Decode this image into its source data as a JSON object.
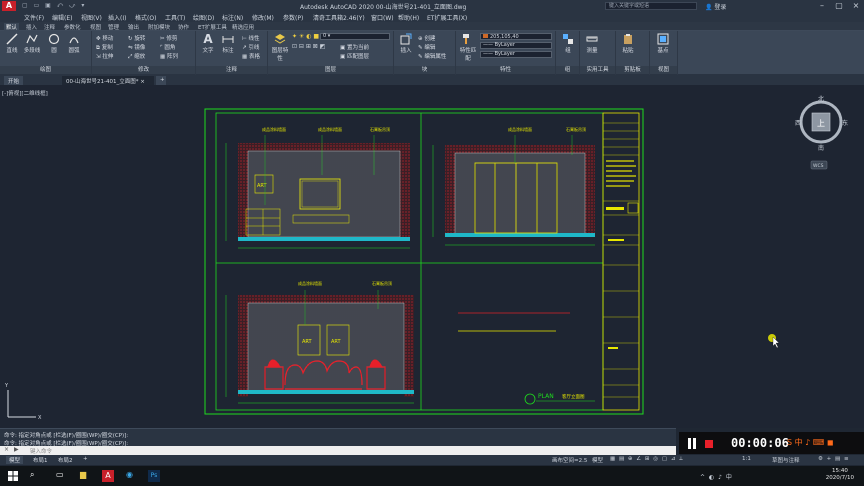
{
  "window": {
    "app_logo": "A",
    "title": "Autodesk AutoCAD 2020    00-山海世号21-401_立面图.dwg",
    "search_placeholder": "键入关键字或短语",
    "user_label": "登录"
  },
  "menubar": [
    "文件(F)",
    "编辑(E)",
    "视图(V)",
    "插入(I)",
    "格式(O)",
    "工具(T)",
    "绘图(D)",
    "标注(N)",
    "修改(M)",
    "参数(P)",
    "清奇工具箱2.46(Y)",
    "窗口(W)",
    "帮助(H)",
    "ET扩展工具(X)"
  ],
  "ribbon_tabs": [
    "默认",
    "插入",
    "注释",
    "参数化",
    "视图",
    "管理",
    "输出",
    "附加模块",
    "协作",
    "ET扩展工具",
    "精选应用"
  ],
  "ribbon": {
    "draw": {
      "title": "绘图",
      "tools": [
        "直线",
        "多段线",
        "圆",
        "圆弧"
      ]
    },
    "modify": {
      "title": "修改",
      "tools": [
        "移动",
        "旋转",
        "修剪",
        "复制",
        "镜像",
        "圆角",
        "拉伸",
        "缩放",
        "阵列"
      ]
    },
    "annotation": {
      "title": "注释",
      "tools": [
        "文字",
        "标注",
        "线性",
        "引线",
        "表格"
      ]
    },
    "layers": {
      "title": "图层",
      "tools": [
        "图层特性",
        "置为当前",
        "匹配图层"
      ],
      "layer_value": "0"
    },
    "block": {
      "title": "块",
      "tools": [
        "插入",
        "创建",
        "编辑",
        "编辑属性"
      ]
    },
    "properties": {
      "title": "特性",
      "tools": [
        "特性匹配"
      ],
      "color_value": "205,105,40",
      "linetype_value": "ByLayer",
      "lineweight_value": "ByLayer"
    },
    "groups": {
      "title": "组",
      "tools": [
        "组"
      ]
    },
    "utilities": {
      "title": "实用工具",
      "tools": [
        "测量"
      ]
    },
    "clipboard": {
      "title": "剪贴板",
      "tools": [
        "粘贴"
      ]
    },
    "view": {
      "title": "视图",
      "tools": [
        "基点"
      ]
    }
  },
  "doc_tabs": [
    "开始",
    "00-山海世号21-401_立面图*"
  ],
  "view_label": "[-]俯视][二维线框]",
  "drawing": {
    "labels_tv_wall": [
      "成品涂料墙面",
      "成品涂料墙面",
      "石膏板吊顶"
    ],
    "labels_door_wall": [
      "成品涂料墙面",
      "石膏板吊顶"
    ],
    "labels_sofa_wall": [
      "成品涂料墙面",
      "石膏板吊顶"
    ],
    "art1": "ART",
    "art2": "ART",
    "art3": "ART",
    "plan_label": "PLAN",
    "plan_title": "客厅立面图"
  },
  "viewcube": {
    "north": "北",
    "south": "南",
    "east": "东",
    "west": "西",
    "top": "上",
    "wcs": "WCS"
  },
  "command": {
    "line1": "命令: 指定对角点或 [栏选(F)/圈围(WP)/圈交(CP)]:",
    "line2": "命令: 指定对角点或 [栏选(F)/圈围(WP)/圈交(CP)]:",
    "input_placeholder": "键入命令"
  },
  "recording": {
    "time": "00:00:06"
  },
  "layout_tabs": [
    "模型",
    "布局1",
    "布局2"
  ],
  "status": {
    "coords": "画布空间=2.5",
    "model": "模型",
    "scale": "1:1",
    "annotation": "草图与注释"
  },
  "taskbar": {
    "time": "15:40",
    "date": "2020/7/10"
  },
  "colors": {
    "frame": "#1edc1e",
    "wall_hatch": "#d8232a",
    "annotation": "#e8e800",
    "dimension": "#14c814",
    "background": "#1e2532"
  }
}
